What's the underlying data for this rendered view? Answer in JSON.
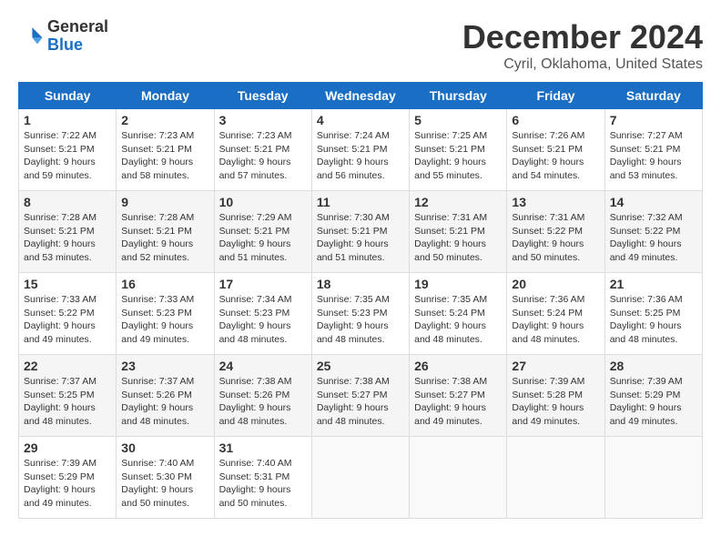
{
  "logo": {
    "text_general": "General",
    "text_blue": "Blue"
  },
  "title": "December 2024",
  "location": "Cyril, Oklahoma, United States",
  "days_of_week": [
    "Sunday",
    "Monday",
    "Tuesday",
    "Wednesday",
    "Thursday",
    "Friday",
    "Saturday"
  ],
  "weeks": [
    [
      {
        "day": "1",
        "info": "Sunrise: 7:22 AM\nSunset: 5:21 PM\nDaylight: 9 hours\nand 59 minutes."
      },
      {
        "day": "2",
        "info": "Sunrise: 7:23 AM\nSunset: 5:21 PM\nDaylight: 9 hours\nand 58 minutes."
      },
      {
        "day": "3",
        "info": "Sunrise: 7:23 AM\nSunset: 5:21 PM\nDaylight: 9 hours\nand 57 minutes."
      },
      {
        "day": "4",
        "info": "Sunrise: 7:24 AM\nSunset: 5:21 PM\nDaylight: 9 hours\nand 56 minutes."
      },
      {
        "day": "5",
        "info": "Sunrise: 7:25 AM\nSunset: 5:21 PM\nDaylight: 9 hours\nand 55 minutes."
      },
      {
        "day": "6",
        "info": "Sunrise: 7:26 AM\nSunset: 5:21 PM\nDaylight: 9 hours\nand 54 minutes."
      },
      {
        "day": "7",
        "info": "Sunrise: 7:27 AM\nSunset: 5:21 PM\nDaylight: 9 hours\nand 53 minutes."
      }
    ],
    [
      {
        "day": "8",
        "info": "Sunrise: 7:28 AM\nSunset: 5:21 PM\nDaylight: 9 hours\nand 53 minutes."
      },
      {
        "day": "9",
        "info": "Sunrise: 7:28 AM\nSunset: 5:21 PM\nDaylight: 9 hours\nand 52 minutes."
      },
      {
        "day": "10",
        "info": "Sunrise: 7:29 AM\nSunset: 5:21 PM\nDaylight: 9 hours\nand 51 minutes."
      },
      {
        "day": "11",
        "info": "Sunrise: 7:30 AM\nSunset: 5:21 PM\nDaylight: 9 hours\nand 51 minutes."
      },
      {
        "day": "12",
        "info": "Sunrise: 7:31 AM\nSunset: 5:21 PM\nDaylight: 9 hours\nand 50 minutes."
      },
      {
        "day": "13",
        "info": "Sunrise: 7:31 AM\nSunset: 5:22 PM\nDaylight: 9 hours\nand 50 minutes."
      },
      {
        "day": "14",
        "info": "Sunrise: 7:32 AM\nSunset: 5:22 PM\nDaylight: 9 hours\nand 49 minutes."
      }
    ],
    [
      {
        "day": "15",
        "info": "Sunrise: 7:33 AM\nSunset: 5:22 PM\nDaylight: 9 hours\nand 49 minutes."
      },
      {
        "day": "16",
        "info": "Sunrise: 7:33 AM\nSunset: 5:23 PM\nDaylight: 9 hours\nand 49 minutes."
      },
      {
        "day": "17",
        "info": "Sunrise: 7:34 AM\nSunset: 5:23 PM\nDaylight: 9 hours\nand 48 minutes."
      },
      {
        "day": "18",
        "info": "Sunrise: 7:35 AM\nSunset: 5:23 PM\nDaylight: 9 hours\nand 48 minutes."
      },
      {
        "day": "19",
        "info": "Sunrise: 7:35 AM\nSunset: 5:24 PM\nDaylight: 9 hours\nand 48 minutes."
      },
      {
        "day": "20",
        "info": "Sunrise: 7:36 AM\nSunset: 5:24 PM\nDaylight: 9 hours\nand 48 minutes."
      },
      {
        "day": "21",
        "info": "Sunrise: 7:36 AM\nSunset: 5:25 PM\nDaylight: 9 hours\nand 48 minutes."
      }
    ],
    [
      {
        "day": "22",
        "info": "Sunrise: 7:37 AM\nSunset: 5:25 PM\nDaylight: 9 hours\nand 48 minutes."
      },
      {
        "day": "23",
        "info": "Sunrise: 7:37 AM\nSunset: 5:26 PM\nDaylight: 9 hours\nand 48 minutes."
      },
      {
        "day": "24",
        "info": "Sunrise: 7:38 AM\nSunset: 5:26 PM\nDaylight: 9 hours\nand 48 minutes."
      },
      {
        "day": "25",
        "info": "Sunrise: 7:38 AM\nSunset: 5:27 PM\nDaylight: 9 hours\nand 48 minutes."
      },
      {
        "day": "26",
        "info": "Sunrise: 7:38 AM\nSunset: 5:27 PM\nDaylight: 9 hours\nand 49 minutes."
      },
      {
        "day": "27",
        "info": "Sunrise: 7:39 AM\nSunset: 5:28 PM\nDaylight: 9 hours\nand 49 minutes."
      },
      {
        "day": "28",
        "info": "Sunrise: 7:39 AM\nSunset: 5:29 PM\nDaylight: 9 hours\nand 49 minutes."
      }
    ],
    [
      {
        "day": "29",
        "info": "Sunrise: 7:39 AM\nSunset: 5:29 PM\nDaylight: 9 hours\nand 49 minutes."
      },
      {
        "day": "30",
        "info": "Sunrise: 7:40 AM\nSunset: 5:30 PM\nDaylight: 9 hours\nand 50 minutes."
      },
      {
        "day": "31",
        "info": "Sunrise: 7:40 AM\nSunset: 5:31 PM\nDaylight: 9 hours\nand 50 minutes."
      },
      null,
      null,
      null,
      null
    ]
  ]
}
